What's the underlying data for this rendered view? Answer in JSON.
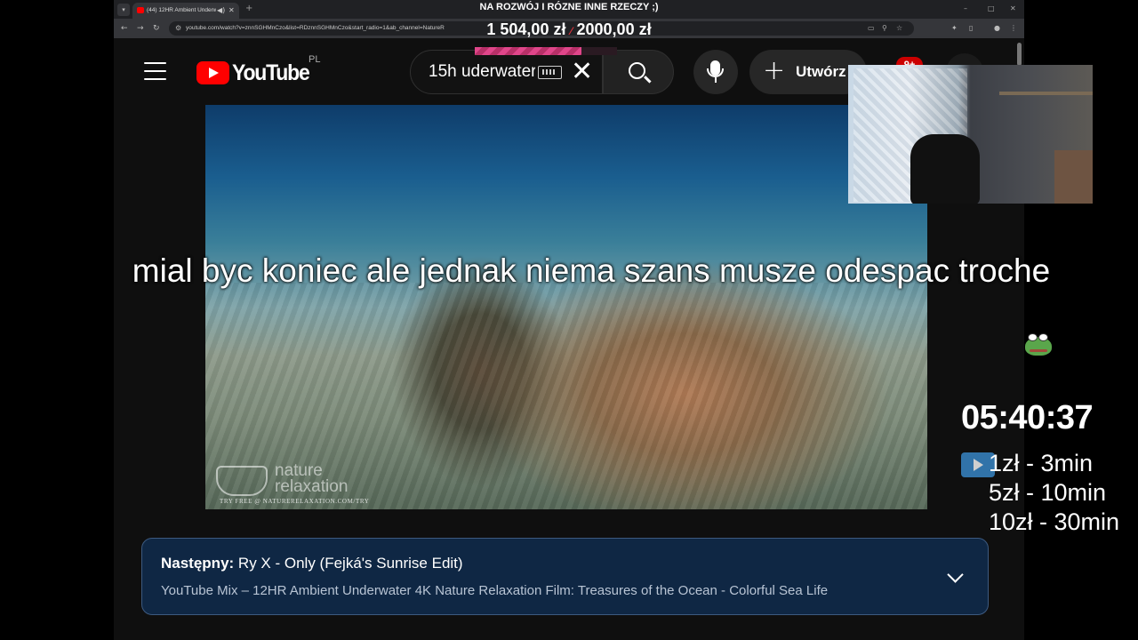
{
  "browser": {
    "tab_title": "(44) 12HR Ambient Underwater",
    "url": "youtube.com/watch?v=znnSGHMnCzo&list=RDznnSGHMnCzo&start_radio=1&ab_channel=NatureR"
  },
  "youtube": {
    "logo_text": "YouTube",
    "country_code": "PL",
    "search_query": "15h uderwater",
    "create_label": "Utwórz",
    "notifications_badge": "9+",
    "up_next": {
      "label": "Następny:",
      "track": "Ry X - Only (Fejká's Sunrise Edit)",
      "mix_title": "YouTube Mix – 12HR Ambient Underwater 4K Nature Relaxation Film: Treasures of the Ocean - Colorful Sea Life"
    },
    "watermark": {
      "line1": "nature",
      "line2": "relaxation",
      "footer": "TRY FREE @ NATURERELAXATION.COM/TRY"
    }
  },
  "overlay": {
    "stream_title": "NA ROZWÓJ I RÓZNE INNE RZECZY ;)",
    "donation_current": "1 504,00 zł",
    "donation_goal": "2000,00 zł",
    "donation_progress": 0.752,
    "caption": "mial byc koniec ale jednak niema szans musze odespac troche",
    "timer": "05:40:37",
    "rates": [
      "1zł - 3min",
      "5zł - 10min",
      "10zł - 30min"
    ]
  },
  "colors": {
    "youtube_red": "#ff0000",
    "up_next_bg": "#0f2744",
    "donation_bar": "#e0468a"
  }
}
